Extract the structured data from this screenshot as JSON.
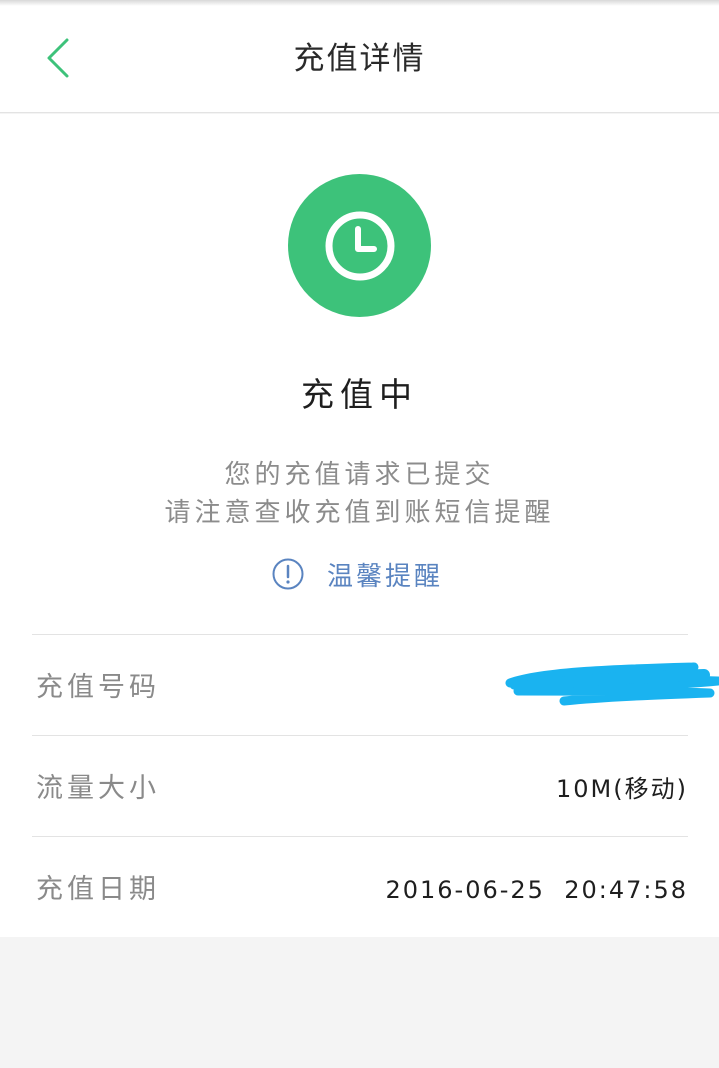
{
  "header": {
    "title": "充值详情",
    "back_icon": "chevron-left-icon"
  },
  "status": {
    "icon": "clock-icon",
    "title": "充值中",
    "message_line1": "您的充值请求已提交",
    "message_line2": "请注意查收充值到账短信提醒"
  },
  "tip": {
    "icon": "exclamation-circle-icon",
    "label": "温馨提醒"
  },
  "details": [
    {
      "label": "充值号码",
      "value": ""
    },
    {
      "label": "流量大小",
      "value": "10M(移动)"
    },
    {
      "label": "充值日期",
      "value": "2016-06-25  20:47:58"
    }
  ],
  "colors": {
    "accent_green": "#3dc27a",
    "link_blue": "#5a84c0",
    "redact_blue": "#1ab3f0"
  }
}
